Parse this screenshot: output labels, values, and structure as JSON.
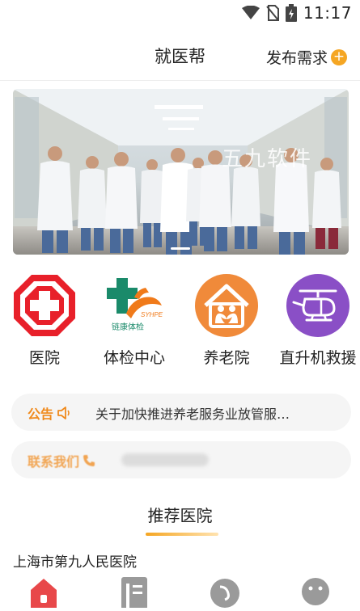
{
  "status_bar": {
    "time": "11:17",
    "icons": [
      "wifi-icon",
      "no-sim-icon",
      "battery-charging-icon"
    ]
  },
  "header": {
    "title": "就医帮",
    "publish_label": "发布需求",
    "publish_icon": "plus-icon"
  },
  "banner": {
    "watermark": "五九软件"
  },
  "categories": [
    {
      "label": "医院",
      "icon": "red-cross-icon",
      "color": "#e8202a"
    },
    {
      "label": "体检中心",
      "icon": "health-checkup-logo-icon",
      "color": "#1a8a6a"
    },
    {
      "label": "养老院",
      "icon": "elderly-care-house-icon",
      "color": "#f08a3a"
    },
    {
      "label": "直升机救援",
      "icon": "helicopter-icon",
      "color": "#8a4fc6"
    }
  ],
  "notice": {
    "tag": "公告",
    "text": "关于加快推进养老服务业放管服…"
  },
  "contact": {
    "tag": "联系我们"
  },
  "recommend": {
    "title": "推荐医院",
    "hospital": "上海市第九人民医院"
  },
  "tabbar": {
    "tabs": [
      "home-icon",
      "article-icon",
      "service-icon",
      "profile-icon"
    ]
  },
  "colors": {
    "accent": "#f5a623",
    "notice_tag": "#f08a1c"
  }
}
